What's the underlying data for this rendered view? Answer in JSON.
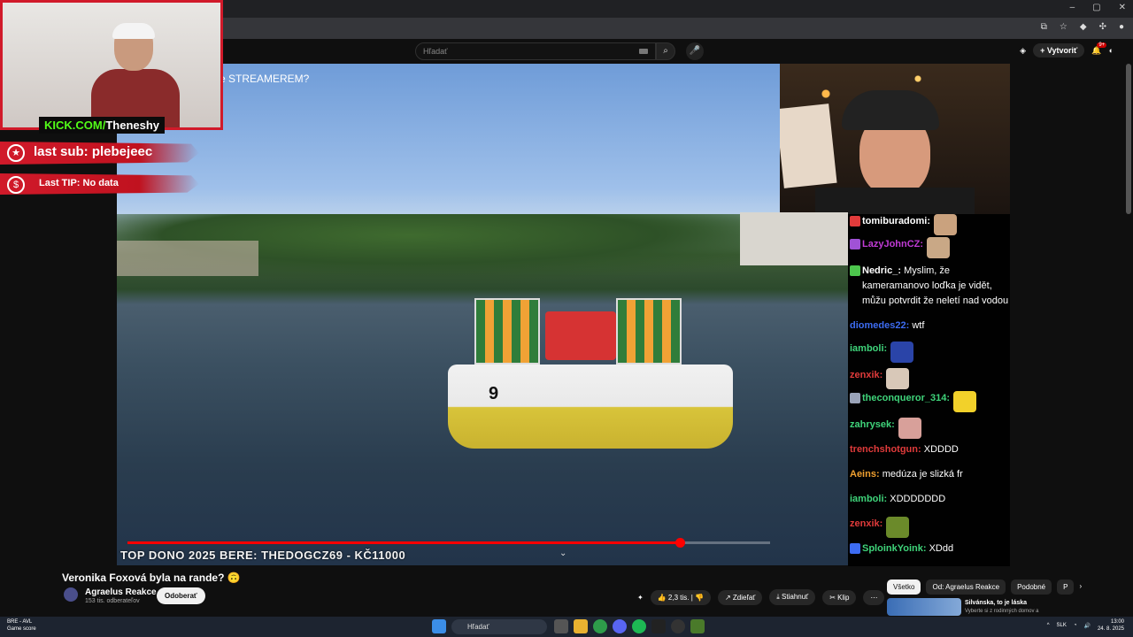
{
  "browser": {
    "window_controls": [
      "–",
      "▢",
      "✕"
    ]
  },
  "youtube": {
    "search_placeholder": "Hľadať",
    "create_label": "Vytvoriť",
    "notif_count": "9+"
  },
  "stream": {
    "video_title_overlay": "e STREAMEREM?",
    "kick_prefix": "KICK.COM/",
    "kick_name": "Theneshy",
    "last_sub": "last sub: plebejeec",
    "last_tip": "Last TIP: No data",
    "top_dono": "TOP DONO 2025 BERE: THEDOGCZ69 - KČ11000",
    "boat_number": "9",
    "progress_fraction": 0.86
  },
  "chat": [
    {
      "user": "tomiburadomi:",
      "text": "",
      "color": "#ffffff",
      "emote": "#caa27e",
      "badge": "#e23b3b"
    },
    {
      "user": "LazyJohnCZ:",
      "text": "",
      "color": "#c13bd6",
      "emote": "#c9a886",
      "badge": "#a052d6"
    },
    {
      "user": "Nedric_:",
      "text": "Myslim, že kameramanovo loďka je vidět, můžu potvrdit že neletí nad vodou",
      "color": "#ffffff",
      "emote": "#8a6a3a",
      "badge": "#4dc64d"
    },
    {
      "user": "diomedes22:",
      "text": "wtf",
      "color": "#3d6cf2",
      "emote": "",
      "badge": ""
    },
    {
      "user": "iamboli:",
      "text": "",
      "color": "#3fd47a",
      "emote": "#2a44a8",
      "badge": ""
    },
    {
      "user": "zenxik:",
      "text": "",
      "color": "#e03b3b",
      "emote": "#d8c8b8",
      "badge": ""
    },
    {
      "user": "theconqueror_314:",
      "text": "",
      "color": "#3fd47a",
      "emote": "#f2d12a",
      "badge": "#9aa3b8"
    },
    {
      "user": "zahrysek:",
      "text": "",
      "color": "#3fd47a",
      "emote": "#d8a09a",
      "badge": ""
    },
    {
      "user": "trenchshotgun:",
      "text": "XDDDD",
      "color": "#e03b3b",
      "emote": "",
      "badge": ""
    },
    {
      "user": "Aeins:",
      "text": "medúza je slizká fr",
      "color": "#f0a030",
      "emote": "",
      "badge": ""
    },
    {
      "user": "iamboli:",
      "text": "XDDDDDDD",
      "color": "#3fd47a",
      "emote": "",
      "badge": ""
    },
    {
      "user": "zenxik:",
      "text": "",
      "color": "#e03b3b",
      "emote": "#6b8a2a",
      "badge": ""
    },
    {
      "user": "SploinkYoink:",
      "text": "XDdd",
      "color": "#3fd47a",
      "emote": "",
      "badge": "#3d6cf2"
    }
  ],
  "below": {
    "title": "Veronika Foxová byla na rande? 🙃",
    "channel": "Agraelus Reakce",
    "subs": "153 tis. odberateľov",
    "subscribe": "Odoberať",
    "likes": "2,3 tis.",
    "share": "Zdieľať",
    "download": "Stiahnuť",
    "clip": "Klip",
    "chips": [
      "Všetko",
      "Od: Agraelus Reakce",
      "Podobné",
      "P"
    ],
    "rec_title": "Silvánska, to je láska",
    "rec_sub": "Vyberte si z rodinných domov a"
  },
  "taskbar": {
    "weather_title": "BRE - AVL",
    "weather_sub": "Game score",
    "search": "Hľadať",
    "lang": "SLK",
    "time": "13:00",
    "date": "24. 8. 2025"
  }
}
